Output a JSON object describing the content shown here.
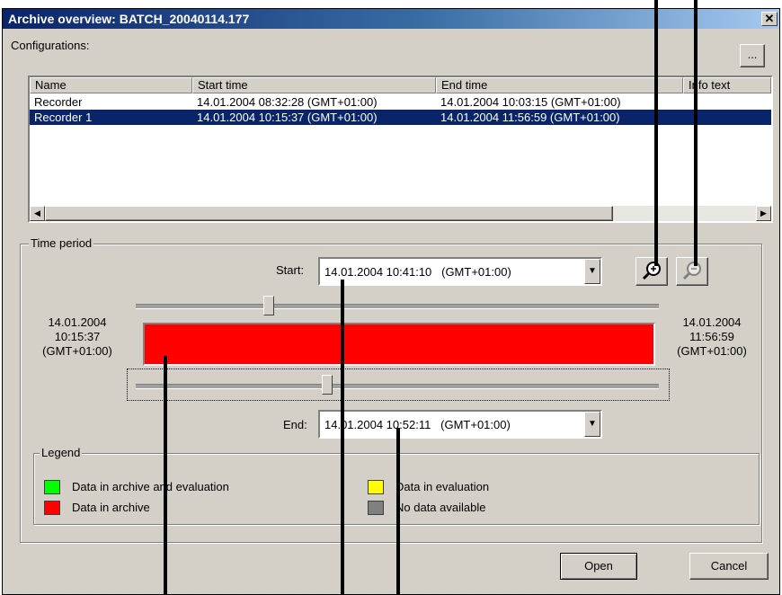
{
  "window": {
    "title": "Archive overview: BATCH_20040114.177",
    "close_glyph": "✕"
  },
  "configurations": {
    "label": "Configurations:",
    "browse_button": "...",
    "columns": [
      "Name",
      "Start time",
      "End time",
      "Info text"
    ],
    "rows": [
      {
        "name": "Recorder",
        "start": "14.01.2004 08:32:28 (GMT+01:00)",
        "end": "14.01.2004 10:03:15 (GMT+01:00)",
        "info": ""
      },
      {
        "name": "Recorder 1",
        "start": "14.01.2004 10:15:37 (GMT+01:00)",
        "end": "14.01.2004 11:56:59 (GMT+01:00)",
        "info": ""
      }
    ],
    "selected_row": 1
  },
  "time_period": {
    "label": "Time period",
    "start_label": "Start:",
    "start_value": "14.01.2004 10:41:10   (GMT+01:00)",
    "end_label": "End:",
    "end_value": "14.01.2004 10:52:11   (GMT+01:00)",
    "range_start": {
      "date": "14.01.2004",
      "time": "10:15:37",
      "tz": "(GMT+01:00)"
    },
    "range_end": {
      "date": "14.01.2004",
      "time": "11:56:59",
      "tz": "(GMT+01:00)"
    },
    "bar_color": "#ff0000",
    "zoom_in_icon": "zoom-in-icon",
    "zoom_out_icon": "zoom-out-icon"
  },
  "legend": {
    "label": "Legend",
    "items": [
      {
        "label": "Data in archive and evaluation",
        "color": "#00ff00"
      },
      {
        "label": "Data in archive",
        "color": "#ff0000"
      },
      {
        "label": "Data in evaluation",
        "color": "#ffff00"
      },
      {
        "label": "No data available",
        "color": "#808080"
      }
    ]
  },
  "buttons": {
    "open": "Open",
    "cancel": "Cancel"
  }
}
